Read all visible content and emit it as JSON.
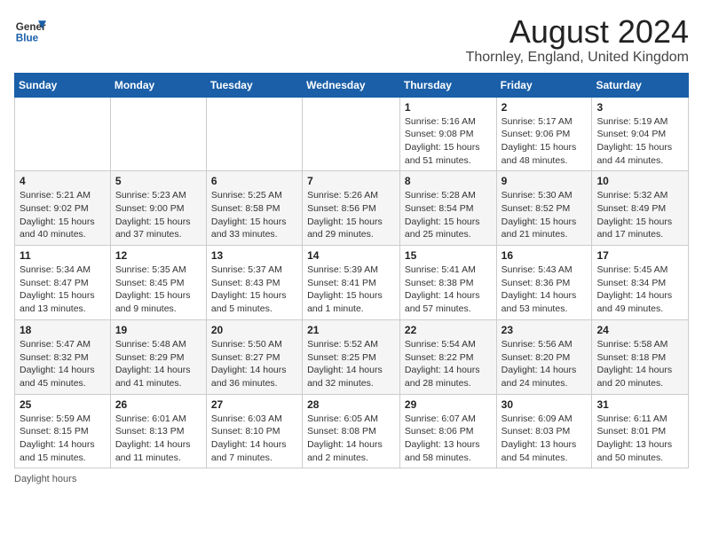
{
  "header": {
    "logo_general": "General",
    "logo_blue": "Blue",
    "month_year": "August 2024",
    "location": "Thornley, England, United Kingdom"
  },
  "days_of_week": [
    "Sunday",
    "Monday",
    "Tuesday",
    "Wednesday",
    "Thursday",
    "Friday",
    "Saturday"
  ],
  "weeks": [
    [
      {
        "day": "",
        "info": ""
      },
      {
        "day": "",
        "info": ""
      },
      {
        "day": "",
        "info": ""
      },
      {
        "day": "",
        "info": ""
      },
      {
        "day": "1",
        "info": "Sunrise: 5:16 AM\nSunset: 9:08 PM\nDaylight: 15 hours\nand 51 minutes."
      },
      {
        "day": "2",
        "info": "Sunrise: 5:17 AM\nSunset: 9:06 PM\nDaylight: 15 hours\nand 48 minutes."
      },
      {
        "day": "3",
        "info": "Sunrise: 5:19 AM\nSunset: 9:04 PM\nDaylight: 15 hours\nand 44 minutes."
      }
    ],
    [
      {
        "day": "4",
        "info": "Sunrise: 5:21 AM\nSunset: 9:02 PM\nDaylight: 15 hours\nand 40 minutes."
      },
      {
        "day": "5",
        "info": "Sunrise: 5:23 AM\nSunset: 9:00 PM\nDaylight: 15 hours\nand 37 minutes."
      },
      {
        "day": "6",
        "info": "Sunrise: 5:25 AM\nSunset: 8:58 PM\nDaylight: 15 hours\nand 33 minutes."
      },
      {
        "day": "7",
        "info": "Sunrise: 5:26 AM\nSunset: 8:56 PM\nDaylight: 15 hours\nand 29 minutes."
      },
      {
        "day": "8",
        "info": "Sunrise: 5:28 AM\nSunset: 8:54 PM\nDaylight: 15 hours\nand 25 minutes."
      },
      {
        "day": "9",
        "info": "Sunrise: 5:30 AM\nSunset: 8:52 PM\nDaylight: 15 hours\nand 21 minutes."
      },
      {
        "day": "10",
        "info": "Sunrise: 5:32 AM\nSunset: 8:49 PM\nDaylight: 15 hours\nand 17 minutes."
      }
    ],
    [
      {
        "day": "11",
        "info": "Sunrise: 5:34 AM\nSunset: 8:47 PM\nDaylight: 15 hours\nand 13 minutes."
      },
      {
        "day": "12",
        "info": "Sunrise: 5:35 AM\nSunset: 8:45 PM\nDaylight: 15 hours\nand 9 minutes."
      },
      {
        "day": "13",
        "info": "Sunrise: 5:37 AM\nSunset: 8:43 PM\nDaylight: 15 hours\nand 5 minutes."
      },
      {
        "day": "14",
        "info": "Sunrise: 5:39 AM\nSunset: 8:41 PM\nDaylight: 15 hours\nand 1 minute."
      },
      {
        "day": "15",
        "info": "Sunrise: 5:41 AM\nSunset: 8:38 PM\nDaylight: 14 hours\nand 57 minutes."
      },
      {
        "day": "16",
        "info": "Sunrise: 5:43 AM\nSunset: 8:36 PM\nDaylight: 14 hours\nand 53 minutes."
      },
      {
        "day": "17",
        "info": "Sunrise: 5:45 AM\nSunset: 8:34 PM\nDaylight: 14 hours\nand 49 minutes."
      }
    ],
    [
      {
        "day": "18",
        "info": "Sunrise: 5:47 AM\nSunset: 8:32 PM\nDaylight: 14 hours\nand 45 minutes."
      },
      {
        "day": "19",
        "info": "Sunrise: 5:48 AM\nSunset: 8:29 PM\nDaylight: 14 hours\nand 41 minutes."
      },
      {
        "day": "20",
        "info": "Sunrise: 5:50 AM\nSunset: 8:27 PM\nDaylight: 14 hours\nand 36 minutes."
      },
      {
        "day": "21",
        "info": "Sunrise: 5:52 AM\nSunset: 8:25 PM\nDaylight: 14 hours\nand 32 minutes."
      },
      {
        "day": "22",
        "info": "Sunrise: 5:54 AM\nSunset: 8:22 PM\nDaylight: 14 hours\nand 28 minutes."
      },
      {
        "day": "23",
        "info": "Sunrise: 5:56 AM\nSunset: 8:20 PM\nDaylight: 14 hours\nand 24 minutes."
      },
      {
        "day": "24",
        "info": "Sunrise: 5:58 AM\nSunset: 8:18 PM\nDaylight: 14 hours\nand 20 minutes."
      }
    ],
    [
      {
        "day": "25",
        "info": "Sunrise: 5:59 AM\nSunset: 8:15 PM\nDaylight: 14 hours\nand 15 minutes."
      },
      {
        "day": "26",
        "info": "Sunrise: 6:01 AM\nSunset: 8:13 PM\nDaylight: 14 hours\nand 11 minutes."
      },
      {
        "day": "27",
        "info": "Sunrise: 6:03 AM\nSunset: 8:10 PM\nDaylight: 14 hours\nand 7 minutes."
      },
      {
        "day": "28",
        "info": "Sunrise: 6:05 AM\nSunset: 8:08 PM\nDaylight: 14 hours\nand 2 minutes."
      },
      {
        "day": "29",
        "info": "Sunrise: 6:07 AM\nSunset: 8:06 PM\nDaylight: 13 hours\nand 58 minutes."
      },
      {
        "day": "30",
        "info": "Sunrise: 6:09 AM\nSunset: 8:03 PM\nDaylight: 13 hours\nand 54 minutes."
      },
      {
        "day": "31",
        "info": "Sunrise: 6:11 AM\nSunset: 8:01 PM\nDaylight: 13 hours\nand 50 minutes."
      }
    ]
  ],
  "footer": {
    "daylight_hours_label": "Daylight hours"
  }
}
